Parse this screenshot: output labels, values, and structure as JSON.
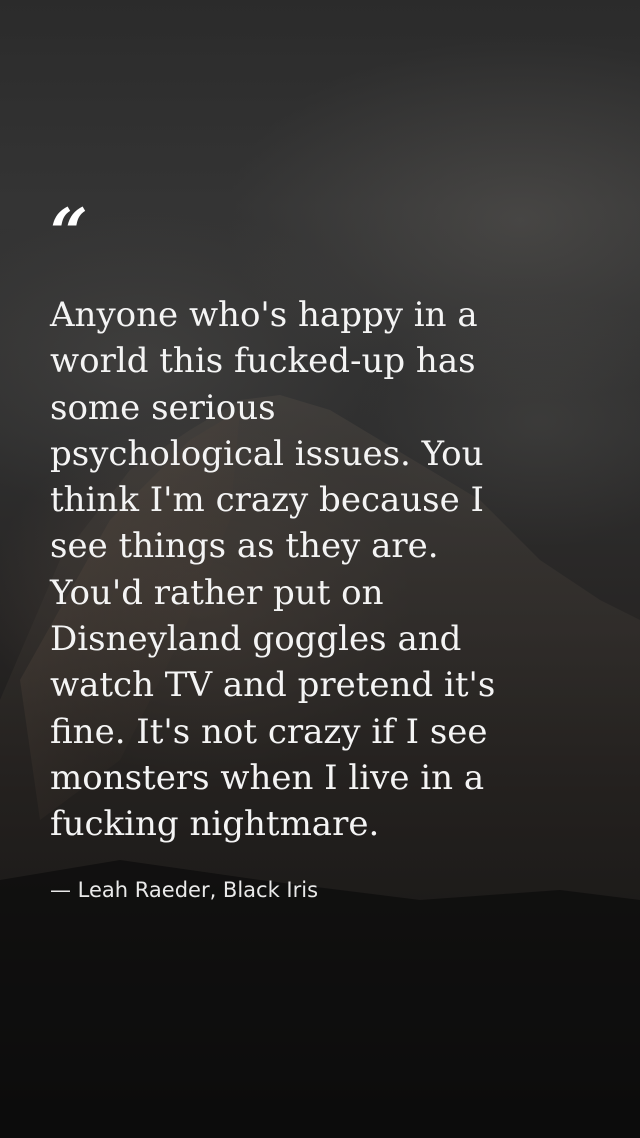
{
  "quote": {
    "mark": "“",
    "text": "Anyone who's happy in a\nworld this fucked-up has\nsome serious\npsychological issues. You\nthink I'm crazy because I\nsee things as they are.\nYou'd rather put on\nDisneyland goggles and\nwatch TV and pretend it's\nfine. It's not crazy if I see\nmonsters when I live in a\nfucking nightmare.",
    "attribution": "— Leah Raeder, Black Iris"
  },
  "colors": {
    "text": "#f4f4f4",
    "background": "#141414"
  }
}
